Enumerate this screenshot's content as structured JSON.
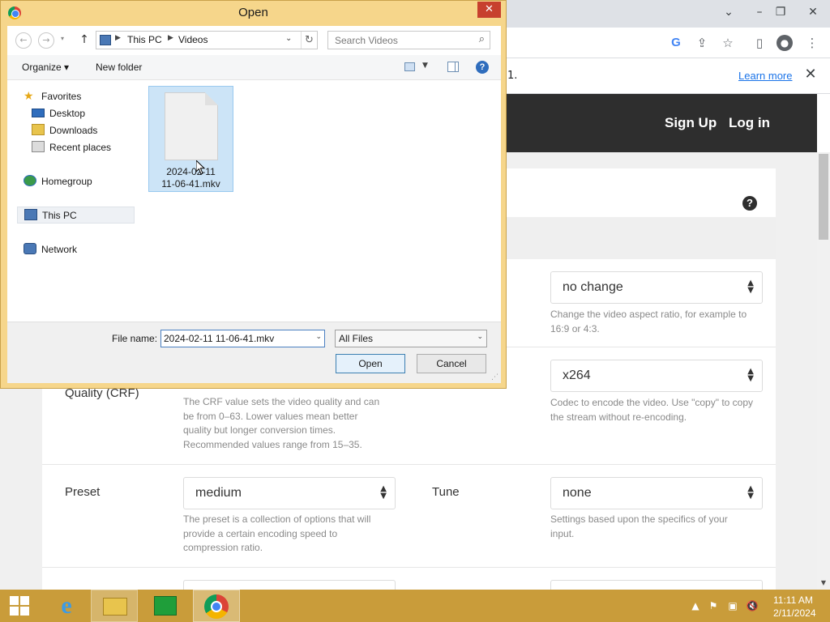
{
  "browser": {
    "infobar_text": "1.",
    "learn_more": "Learn more"
  },
  "site": {
    "signup": "Sign Up",
    "login": "Log in"
  },
  "options": {
    "aspect": {
      "value": "no change",
      "help": [
        "Change the video aspect ratio, for example to",
        "16:9 or 4:3."
      ]
    },
    "quality_label": "Quality (CRF)",
    "quality_help": [
      "The CRF value sets the video quality and can",
      "be from 0–63. Lower values mean better",
      "quality but longer conversion times.",
      "Recommended values range from 15–35."
    ],
    "codec": {
      "value": "x264",
      "help": [
        "Codec to encode the video. Use \"copy\" to copy",
        "the stream without re-encoding."
      ]
    },
    "preset": {
      "label": "Preset",
      "value": "medium",
      "help": [
        "The preset is a collection of options that will",
        "provide a certain encoding speed to",
        "compression ratio."
      ]
    },
    "tune": {
      "label": "Tune",
      "value": "none",
      "help": [
        "Settings based upon the specifics of your",
        "input."
      ]
    }
  },
  "dialog": {
    "title": "Open",
    "breadcrumb": [
      "This PC",
      "Videos"
    ],
    "search_placeholder": "Search Videos",
    "organize": "Organize ▾",
    "new_folder": "New folder",
    "nav_items": [
      "Favorites",
      "Desktop",
      "Downloads",
      "Recent places",
      "Homegroup",
      "This PC",
      "Network"
    ],
    "file": {
      "name_line1": "2024-02-11",
      "name_line2": "11-06-41.mkv"
    },
    "file_name_label": "File name:",
    "file_name_value": "2024-02-11 11-06-41.mkv",
    "file_type_value": "All Files",
    "open_label": "Open",
    "cancel_label": "Cancel"
  },
  "taskbar": {
    "time": "11:11 AM",
    "date": "2/11/2024"
  },
  "colors": {
    "dialog_frame": "#f6d68b",
    "taskbar": "#c99c3a",
    "site_header": "#2e2e2e",
    "selection": "#cce4f7",
    "link": "#1a73e8"
  }
}
